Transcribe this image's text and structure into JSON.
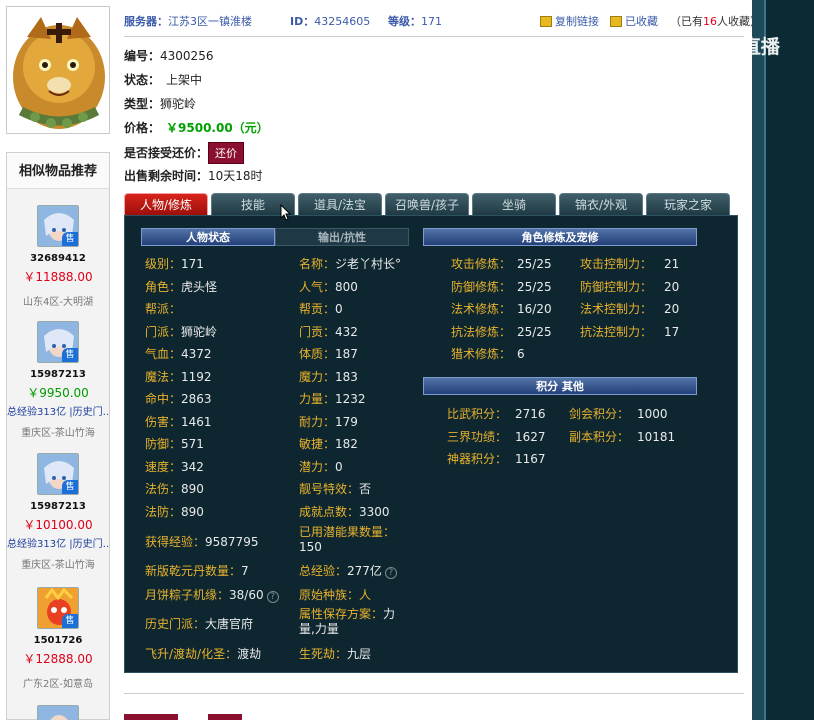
{
  "header": {
    "server_label": "服务器：",
    "server_value": "江苏3区一镇淮楼",
    "id_label": "ID：",
    "id_value": "43254605",
    "level_label": "等级：",
    "level_value": "171",
    "copy_link": "复制链接",
    "favorited": "已收藏",
    "fav_count_prefix": "（已有",
    "fav_count": "16",
    "fav_count_suffix": "人收藏）"
  },
  "info": {
    "number_label": "编号：",
    "number_value": "4300256",
    "status_label": "状态：",
    "status_value": "上架中",
    "type_label": "类型：",
    "type_value": "狮驼岭",
    "price_label": "价格：",
    "price_value": "￥9500.00（元）",
    "bargain_label": "是否接受还价：",
    "bargain_button": "还价",
    "remaining_label": "出售剩余时间：",
    "remaining_value": "10天18时"
  },
  "sidebar": {
    "title": "相似物品推荐",
    "items": [
      {
        "id": "32689412",
        "price": "￥11888.00",
        "price_color": "red",
        "desc": "",
        "area": "山东4区-大明湖"
      },
      {
        "id": "15987213",
        "price": "￥9950.00",
        "price_color": "green",
        "desc": "总经验313亿 |历史门…",
        "area": "重庆区-茶山竹海"
      },
      {
        "id": "15987213",
        "price": "￥10100.00",
        "price_color": "red",
        "desc": "总经验313亿 |历史门…",
        "area": "重庆区-茶山竹海"
      },
      {
        "id": "1501726",
        "price": "￥12888.00",
        "price_color": "red",
        "desc": "",
        "area": "广东2区-如意岛"
      }
    ],
    "sell_tag": "售"
  },
  "tabs": [
    "人物/修炼",
    "技能",
    "道具/法宝",
    "召唤兽/孩子",
    "坐骑",
    "锦衣/外观",
    "玩家之家"
  ],
  "panel": {
    "left_headers": [
      "人物状态",
      "输出/抗性"
    ],
    "cultivation_header": "角色修炼及宠修",
    "points_header": "积分  其他",
    "col1": [
      {
        "k": "级别：",
        "v": "171"
      },
      {
        "k": "角色：",
        "v": "虎头怪"
      },
      {
        "k": "帮派：",
        "v": ""
      },
      {
        "k": "门派：",
        "v": "狮驼岭"
      },
      {
        "k": "气血：",
        "v": "4372"
      },
      {
        "k": "魔法：",
        "v": "1192"
      },
      {
        "k": "命中：",
        "v": "2863"
      },
      {
        "k": "伤害：",
        "v": "1461"
      },
      {
        "k": "防御：",
        "v": "571"
      },
      {
        "k": "速度：",
        "v": "342"
      },
      {
        "k": "法伤：",
        "v": "890"
      },
      {
        "k": "法防：",
        "v": "890"
      },
      {
        "k": "获得经验：",
        "v": "9587795"
      },
      {
        "k": "新版乾元丹数量：",
        "v": "7"
      },
      {
        "k": "月饼粽子机缘：",
        "v": "38/60"
      },
      {
        "k": "历史门派：",
        "v": "大唐官府"
      },
      {
        "k": "飞升/渡劫/化圣：",
        "v": "渡劫"
      }
    ],
    "col2": [
      {
        "k": "名称：",
        "v": "ジ老丫村长°"
      },
      {
        "k": "人气：",
        "v": "800"
      },
      {
        "k": "帮贡：",
        "v": "0"
      },
      {
        "k": "门贡：",
        "v": "432"
      },
      {
        "k": "体质：",
        "v": "187"
      },
      {
        "k": "魔力：",
        "v": "183"
      },
      {
        "k": "力量：",
        "v": "1232"
      },
      {
        "k": "耐力：",
        "v": "179"
      },
      {
        "k": "敏捷：",
        "v": "182"
      },
      {
        "k": "潜力：",
        "v": "0"
      },
      {
        "k": "靓号特效：",
        "v": "否"
      },
      {
        "k": "成就点数：",
        "v": "3300"
      },
      {
        "k": "已用潜能果数量：",
        "v": "150"
      },
      {
        "k": "总经验：",
        "v": "277亿"
      },
      {
        "k": "原始种族：",
        "v": "人"
      },
      {
        "k": "属性保存方案：",
        "v": "力量,力量"
      },
      {
        "k": "生死劫：",
        "v": "九层"
      }
    ],
    "cultivation": [
      {
        "k": "攻击修炼：",
        "v": "25/25",
        "k2": "攻击控制力：",
        "v2": "21"
      },
      {
        "k": "防御修炼：",
        "v": "25/25",
        "k2": "防御控制力：",
        "v2": "20"
      },
      {
        "k": "法术修炼：",
        "v": "16/20",
        "k2": "法术控制力：",
        "v2": "20"
      },
      {
        "k": "抗法修炼：",
        "v": "25/25",
        "k2": "抗法控制力：",
        "v2": "17"
      },
      {
        "k": "猎术修炼：",
        "v": "6",
        "k2": "",
        "v2": ""
      }
    ],
    "points": [
      {
        "k": "比武积分：",
        "v": "2716",
        "k2": "剑会积分：",
        "v2": "1000"
      },
      {
        "k": "三界功绩：",
        "v": "1627",
        "k2": "副本积分：",
        "v2": "10181"
      },
      {
        "k": "神器积分：",
        "v": "1167",
        "k2": "",
        "v2": ""
      }
    ]
  },
  "watermark": "CC直播",
  "colors": {
    "accent_red": "#8b1030",
    "tab_active": "#c81e16",
    "panel_bg": "#0d2630",
    "key_color": "#e8b22c"
  }
}
